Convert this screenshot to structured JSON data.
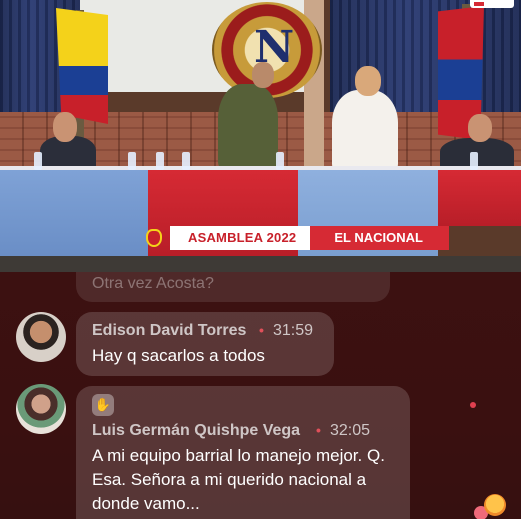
{
  "stream": {
    "banner_primary": "ASAMBLEA 2022",
    "banner_secondary": "EL NACIONAL",
    "emblem_letter": "N"
  },
  "chat": {
    "faded_message": "Otra vez Acosta?",
    "messages": [
      {
        "author": "Edison David Torres",
        "separator": "•",
        "timestamp": "31:59",
        "text": "Hay q sacarlos a todos",
        "avatar_icon": "user-avatar-icon"
      },
      {
        "author": "Luis Germán Quishpe Vega",
        "separator": "•",
        "timestamp": "32:05",
        "text": "A mi equipo barrial lo manejo mejor. Q. Esa. Señora a mi querido nacional a donde vamo...",
        "avatar_icon": "user-avatar-icon",
        "badge_icon": "raised-hand-icon"
      }
    ]
  },
  "colors": {
    "accent_red": "#d62a34",
    "chat_bg": "#3a1010",
    "separator": "#e0505a"
  }
}
